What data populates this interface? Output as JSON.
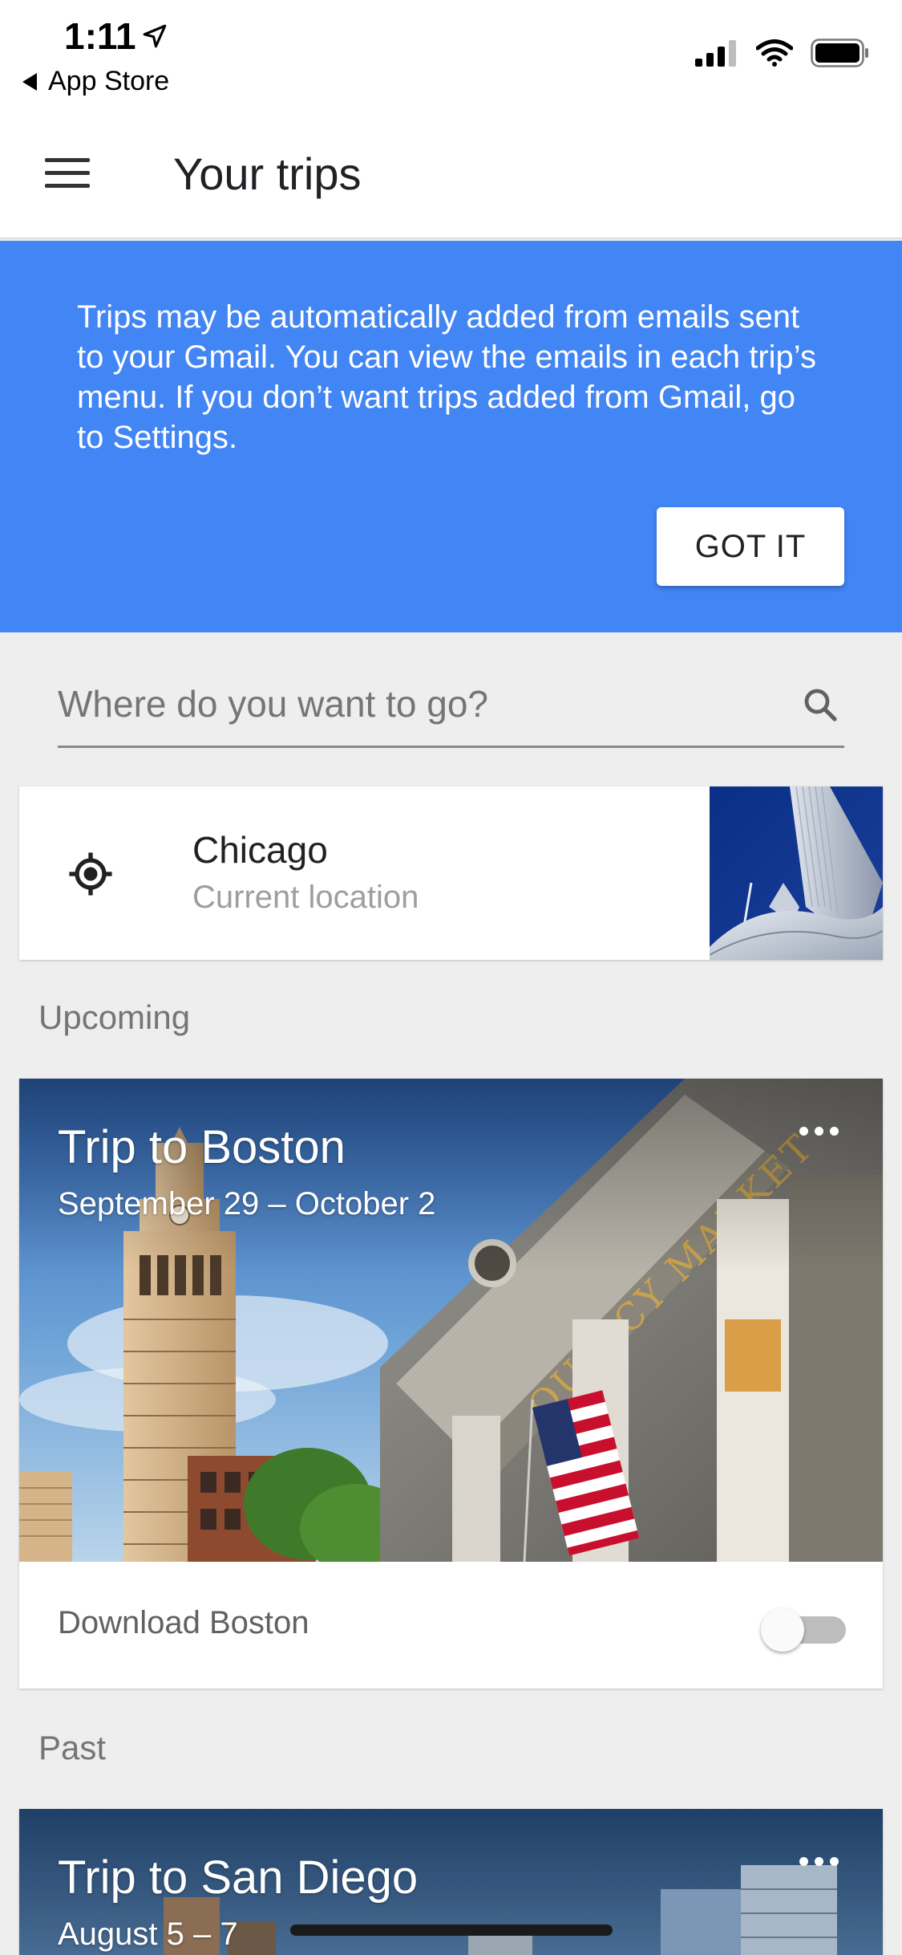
{
  "status_bar": {
    "time": "1:11",
    "back_label": "App Store"
  },
  "app_bar": {
    "title": "Your trips"
  },
  "banner": {
    "message": "Trips may be automatically added from emails sent to your Gmail. You can view the emails in each trip’s menu. If you don’t want trips added from Gmail, go to Settings.",
    "button_label": "GOT IT",
    "color": "#4285f4"
  },
  "search": {
    "placeholder": "Where do you want to go?"
  },
  "current_location": {
    "city": "Chicago",
    "subtitle": "Current location"
  },
  "sections": {
    "upcoming": "Upcoming",
    "past": "Past"
  },
  "upcoming_trips": [
    {
      "title": "Trip to Boston",
      "dates": "September 29 – October 2",
      "download_label": "Download Boston",
      "download_enabled": false
    }
  ],
  "past_trips": [
    {
      "title": "Trip to San Diego",
      "dates": "August 5 – 7"
    }
  ]
}
